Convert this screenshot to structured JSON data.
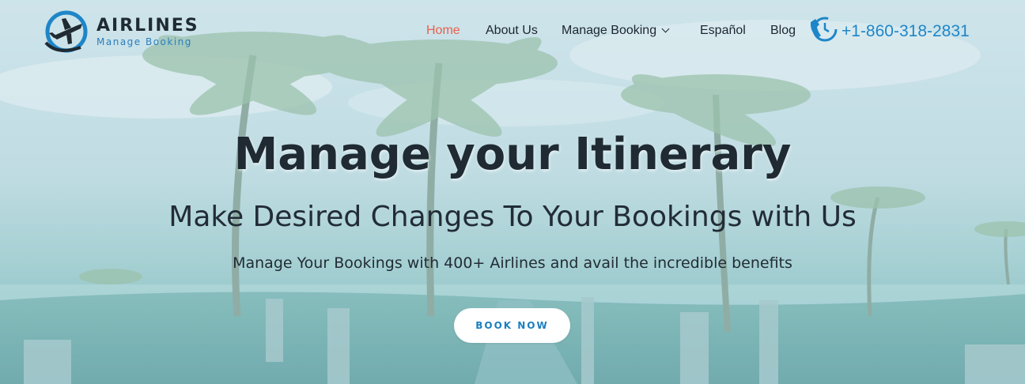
{
  "brand": {
    "title": "AIRLINES",
    "subtitle": "Manage Booking"
  },
  "nav": {
    "items": [
      {
        "label": "Home",
        "active": true
      },
      {
        "label": "About Us",
        "active": false
      },
      {
        "label": "Manage Booking",
        "active": false,
        "has_dropdown": true
      },
      {
        "label": "Español",
        "active": false
      },
      {
        "label": "Blog",
        "active": false
      }
    ],
    "phone": "+1-860-318-2831",
    "phone_icon": "phone-24h-icon"
  },
  "hero": {
    "heading": "Manage your Itinerary",
    "subheading": "Make Desired Changes To Your Bookings with Us",
    "lead": "Manage Your Bookings with 400+ Airlines and avail the incredible benefits",
    "cta_label": "BOOK NOW"
  },
  "colors": {
    "accent": "#1e86c8",
    "active_nav": "#e8604c",
    "text_dark": "#1f2a33"
  }
}
